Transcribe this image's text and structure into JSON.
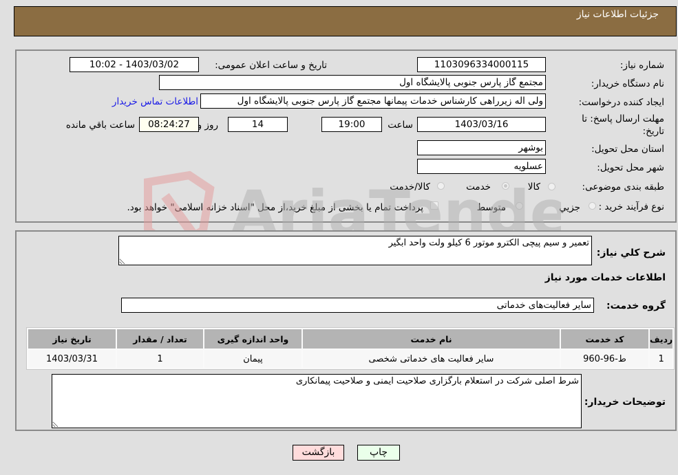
{
  "header": {
    "title": "جزئیات اطلاعات نیاز"
  },
  "fields": {
    "need_number": {
      "label": "شماره نیاز:",
      "value": "1103096334000115"
    },
    "announce_datetime": {
      "label": "تاریخ و ساعت اعلان عمومی:",
      "value": "1403/03/02 - 10:02"
    },
    "buyer_org": {
      "label": "نام دستگاه خریدار:",
      "value": "مجتمع گاز پارس جنوبی  پالایشگاه اول"
    },
    "requester": {
      "label": "ایجاد کننده درخواست:",
      "value": "ولی اله زیرراهی کارشناس خدمات پیمانها مجتمع گاز پارس جنوبی  پالایشگاه اول"
    },
    "buyer_contact_link": "اطلاعات تماس خریدار",
    "deadline": {
      "label": "مهلت ارسال پاسخ: تا تاریخ:",
      "date": "1403/03/16",
      "time_label": "ساعت",
      "time": "19:00",
      "days": "14",
      "days_label": "روز و",
      "remaining": "08:24:27",
      "remaining_label": "ساعت باقي مانده"
    },
    "province": {
      "label": "استان محل تحویل:",
      "value": "بوشهر"
    },
    "city": {
      "label": "شهر محل تحویل:",
      "value": "عسلویه"
    },
    "category": {
      "label": "طبقه بندی موضوعی:",
      "options": [
        "کالا",
        "خدمت",
        "کالا/خدمت"
      ],
      "selected": "خدمت"
    },
    "purchase_type": {
      "label": "نوع فرآیند خرید :",
      "options": [
        "جزيي",
        "متوسط"
      ],
      "selected": "متوسط",
      "treasury_note": "پرداخت تمام یا بخشی از مبلغ خرید،از محل \"اسناد خزانه اسلامی\" خواهد بود."
    }
  },
  "description": {
    "label": "شرح كلي نياز:",
    "value": "تعمیر و سیم پیچی الکترو موتور 6 کیلو ولت واحد ابگیر"
  },
  "services_title": "اطلاعات خدمات مورد نياز",
  "service_group": {
    "label": "گروه خدمت:",
    "value": "سایر فعالیت‌های خدماتی"
  },
  "table": {
    "headers": [
      "ردیف",
      "کد خدمت",
      "نام خدمت",
      "واحد اندازه گیری",
      "تعداد / مقدار",
      "تاریخ نیاز"
    ],
    "rows": [
      [
        "1",
        "ط-96-960",
        "سایر فعالیت های خدماتی شخصی",
        "پیمان",
        "1",
        "1403/03/31"
      ]
    ]
  },
  "buyer_notes": {
    "label": "توضیحات خریدار:",
    "value": "شرط اصلی شرکت در استعلام بارگزاری صلاحیت ایمنی و صلاحیت پیمانکاری"
  },
  "buttons": {
    "print": "چاپ",
    "back": "بازگشت"
  },
  "colors": {
    "header_bg": "#8b6d42",
    "print_bg": "#eaffea",
    "back_bg": "#ffdcdc",
    "link": "#1a1ae6"
  },
  "watermark": "AriaTender.net"
}
